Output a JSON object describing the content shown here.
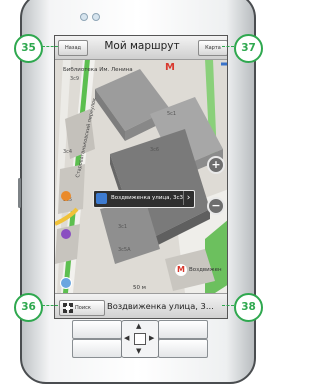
{
  "header": {
    "title": "Мой маршрут",
    "left_button": "Назад",
    "right_button": "Карта"
  },
  "map": {
    "labels": {
      "library": "Библиотека Им. Ленина",
      "metro_top": "М",
      "house_3s9": "3с9",
      "house_5s1": "5с1",
      "house_3s6": "3с6",
      "house_3s4": "3с4",
      "house_3s5": "3с5",
      "house_3s1": "3с1",
      "house_3s5a": "3с5А",
      "street_side": "Староваганьковский переулок",
      "metro_bottom": "М",
      "vozdvizhenka": "Воздвижен",
      "scale": "50 м"
    },
    "popup_text": "Воздвиженка улица, 3с3",
    "zoom_in": "+",
    "zoom_out": "−"
  },
  "footer": {
    "search_button": "Поиск",
    "address": "Воздвиженка улица, 3..."
  },
  "callouts": [
    "35",
    "37",
    "36",
    "38"
  ],
  "icons": {
    "home": "home-icon",
    "next": "chevron-right-icon",
    "search": "search-icon",
    "metro": "metro-icon",
    "location": "location-icon"
  }
}
